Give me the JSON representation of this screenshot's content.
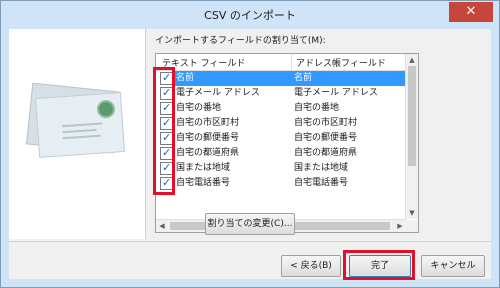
{
  "window": {
    "title": "CSV のインポート",
    "close_glyph": "✕"
  },
  "mapping": {
    "label": "インポートするフィールドの割り当て(M):",
    "columns": {
      "text_field": "テキスト フィールド",
      "address_field": "アドレス帳フィールド"
    },
    "rows": [
      {
        "text": "名前",
        "address": "名前",
        "checked": true,
        "selected": true
      },
      {
        "text": "電子メール アドレス",
        "address": "電子メール アドレス",
        "checked": true,
        "selected": false
      },
      {
        "text": "自宅の番地",
        "address": "自宅の番地",
        "checked": true,
        "selected": false
      },
      {
        "text": "自宅の市区町村",
        "address": "自宅の市区町村",
        "checked": true,
        "selected": false
      },
      {
        "text": "自宅の郵便番号",
        "address": "自宅の郵便番号",
        "checked": true,
        "selected": false
      },
      {
        "text": "自宅の都道府県",
        "address": "自宅の都道府県",
        "checked": true,
        "selected": false
      },
      {
        "text": "国または地域",
        "address": "国または地域",
        "checked": true,
        "selected": false
      },
      {
        "text": "自宅電話番号",
        "address": "自宅電話番号",
        "checked": true,
        "selected": false
      }
    ]
  },
  "buttons": {
    "change_mapping": "割り当ての変更(C)...",
    "back": "< 戻る(B)",
    "finish": "完了",
    "cancel": "キャンセル"
  },
  "icons": {
    "checkmark": "✓",
    "scroll_up": "▲",
    "scroll_down": "▼",
    "scroll_left": "◀",
    "scroll_right": "▶"
  },
  "colors": {
    "highlight": "#e0102a",
    "selection": "#3399ff"
  }
}
